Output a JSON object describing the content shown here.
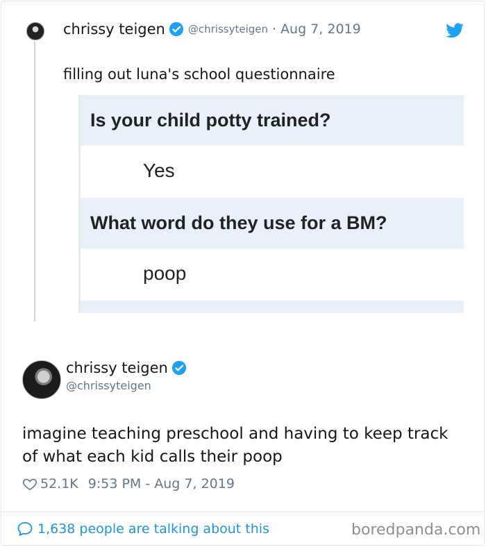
{
  "colors": {
    "accent": "#1da1f2",
    "link": "#1b95e0",
    "muted": "#657786",
    "question_bg": "#e9f0f9"
  },
  "parent_tweet": {
    "name": "chrissy teigen",
    "handle": "@chrissyteigen",
    "separator": "·",
    "date": "Aug 7, 2019",
    "text": "filling out luna's school questionnaire",
    "media": {
      "q1": "Is your child potty trained?",
      "a1": "Yes",
      "q2": "What word do they use for a BM?",
      "a2": "poop"
    }
  },
  "main_tweet": {
    "name": "chrissy teigen",
    "handle": "@chrissyteigen",
    "text": "imagine teaching preschool and having to keep track of what each kid calls their poop",
    "likes": "52.1K",
    "timestamp": "9:53 PM - Aug 7, 2019"
  },
  "footer": {
    "talking": "1,638 people are talking about this",
    "watermark": "boredpanda.com"
  },
  "icons": [
    "verified-icon",
    "twitter-bird-icon",
    "heart-icon",
    "speech-bubble-icon"
  ]
}
